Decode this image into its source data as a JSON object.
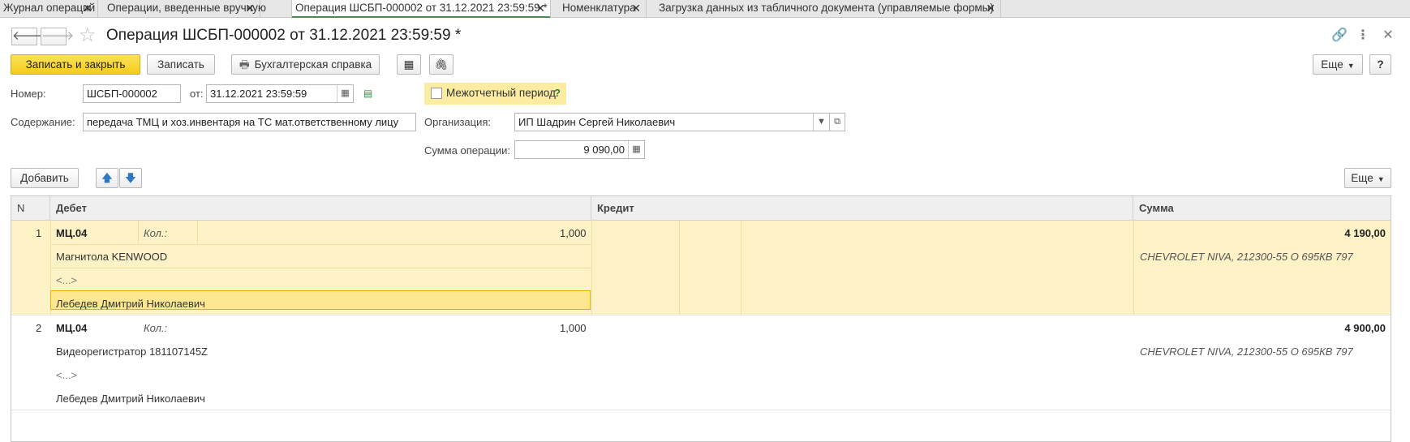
{
  "tabs": [
    {
      "label": "Журнал операций"
    },
    {
      "label": "Операции, введенные вручную"
    },
    {
      "label": "Операция ШСБП-000002 от 31.12.2021 23:59:59 *"
    },
    {
      "label": "Номенклатура"
    },
    {
      "label": "Загрузка данных из табличного документа (управляемые формы)"
    }
  ],
  "tab_close": "✕",
  "header": {
    "back": "🡐",
    "forward": "🡒",
    "title": "Операция ШСБП-000002 от 31.12.2021 23:59:59 *"
  },
  "toolbar": {
    "save_close": "Записать и закрыть",
    "save": "Записать",
    "report": "Бухгалтерская справка",
    "more": "Еще",
    "help": "?"
  },
  "form": {
    "number_label": "Номер:",
    "number_value": "ШСБП-000002",
    "date_label": "от:",
    "date_value": "31.12.2021 23:59:59",
    "interperiod_label": "Межотчетный период",
    "interperiod_help": "?",
    "content_label": "Содержание:",
    "content_value": "передача ТМЦ и хоз.инвентаря на ТС мат.ответственному лицу",
    "org_label": "Организация:",
    "org_value": "ИП Шадрин Сергей Николаевич",
    "sum_label": "Сумма операции:",
    "sum_value": "9 090,00"
  },
  "table_toolbar": {
    "add": "Добавить",
    "more": "Еще"
  },
  "table": {
    "columns": {
      "n": "N",
      "debit": "Дебет",
      "credit": "Кредит",
      "sum": "Сумма"
    },
    "rows": [
      {
        "n": "1",
        "account": "МЦ.04",
        "qty_label": "Кол.:",
        "qty": "1,000",
        "item": "Магнитола KENWOOD",
        "sub2": "<...>",
        "person": "Лебедев Дмитрий Николаевич",
        "sum": "4 190,00",
        "sum_note": "CHEVROLET NIVA, 212300-55  О 695КВ 797"
      },
      {
        "n": "2",
        "account": "МЦ.04",
        "qty_label": "Кол.:",
        "qty": "1,000",
        "item": "Видеорегистратор 181107145Z",
        "sub2": "<...>",
        "person": "Лебедев Дмитрий Николаевич",
        "sum": "4 900,00",
        "sum_note": "CHEVROLET NIVA, 212300-55  О 695КВ 797"
      }
    ]
  }
}
